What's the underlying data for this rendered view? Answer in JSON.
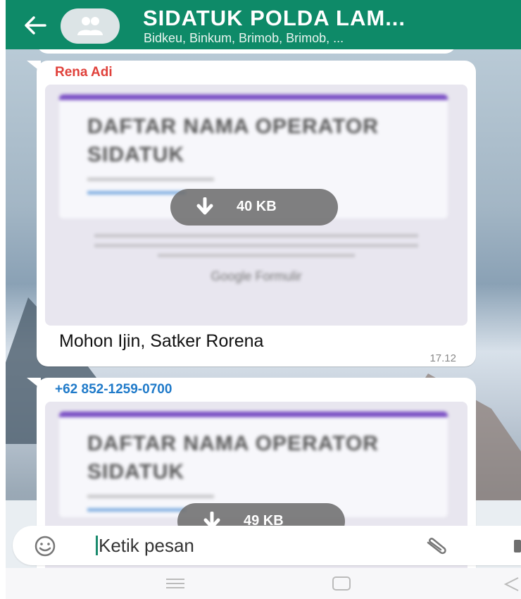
{
  "header": {
    "title": "SIDATUK POLDA LAM...",
    "subtitle": "Bidkeu, Binkum, Brimob, Brimob, ..."
  },
  "messages": [
    {
      "sender": "Rena Adi",
      "form_title": "DAFTAR NAMA OPERATOR SIDATUK",
      "form_footer": "Google Formulir",
      "file_size": "40 KB",
      "caption": "Mohon Ijin, Satker Rorena",
      "time": "17.12"
    },
    {
      "sender": "+62 852-1259-0700",
      "form_title": "DAFTAR NAMA OPERATOR SIDATUK",
      "file_size": "49 KB"
    }
  ],
  "input": {
    "placeholder": "Ketik pesan"
  },
  "colors": {
    "header": "#0e8a68",
    "sender_red": "#e0413b",
    "sender_blue": "#1f7ac9",
    "form_accent": "#7a4fc4"
  },
  "icons": {
    "back": "arrow-left",
    "avatar": "group",
    "download": "arrow-down",
    "emoji": "smiley",
    "attach": "paperclip"
  }
}
